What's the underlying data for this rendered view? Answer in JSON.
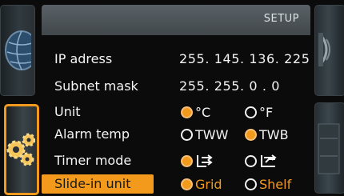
{
  "header": {
    "title": "SETUP"
  },
  "settings": {
    "ip": {
      "label": "IP adress",
      "value": "255. 145. 136. 225"
    },
    "subnet": {
      "label": "Subnet mask",
      "value": "255. 255. 0 . 0"
    },
    "unit": {
      "label": "Unit",
      "options": [
        "°C",
        "°F"
      ],
      "selected": "°C"
    },
    "alarm": {
      "label": "Alarm temp",
      "options": [
        "TWW",
        "TWB"
      ],
      "selected": "TWB"
    },
    "timer": {
      "label": "Timer mode",
      "options": [
        "timer-mode-1-icon",
        "timer-mode-2-icon"
      ],
      "selected": "timer-mode-1-icon"
    },
    "slidein": {
      "label": "Slide-in unit",
      "options": [
        "Grid",
        "Shelf"
      ],
      "selected": "Grid"
    }
  },
  "colors": {
    "accent": "#f39a1d",
    "background": "#0b0b0b",
    "header": "#4a5055"
  },
  "icons": [
    "globe-icon",
    "gears-icon",
    "fan-icon",
    "panel-icon"
  ]
}
